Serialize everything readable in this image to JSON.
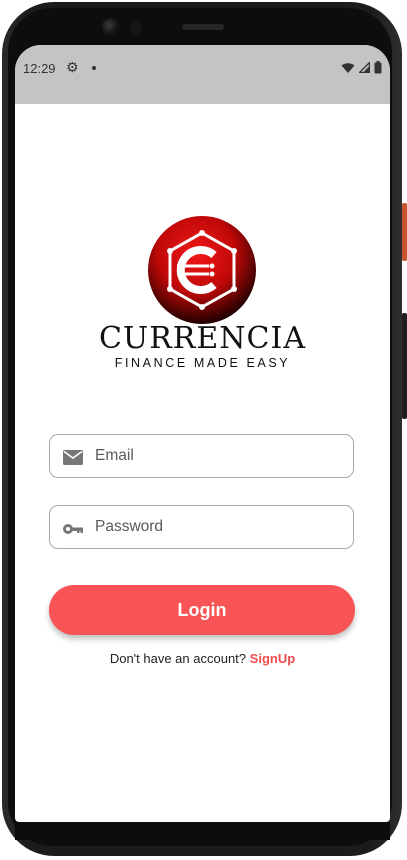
{
  "status_bar": {
    "time": "12:29",
    "icons": [
      "settings-icon",
      "notification-dot-icon",
      "wifi-icon",
      "signal-icon",
      "battery-icon"
    ]
  },
  "brand": {
    "name": "CURRENCIA",
    "tagline": "FINANCE MADE EASY",
    "logo_colors": {
      "red": "#e01010",
      "dark": "#1a0000"
    }
  },
  "form": {
    "email": {
      "placeholder": "Email",
      "value": "",
      "icon": "mail-icon"
    },
    "password": {
      "placeholder": "Password",
      "value": "",
      "icon": "key-icon"
    },
    "login_label": "Login",
    "prompt_text": "Don't have an account?",
    "signup_label": "SignUp"
  },
  "colors": {
    "accent": "#f85456",
    "statusbar": "#c4c4c4"
  }
}
